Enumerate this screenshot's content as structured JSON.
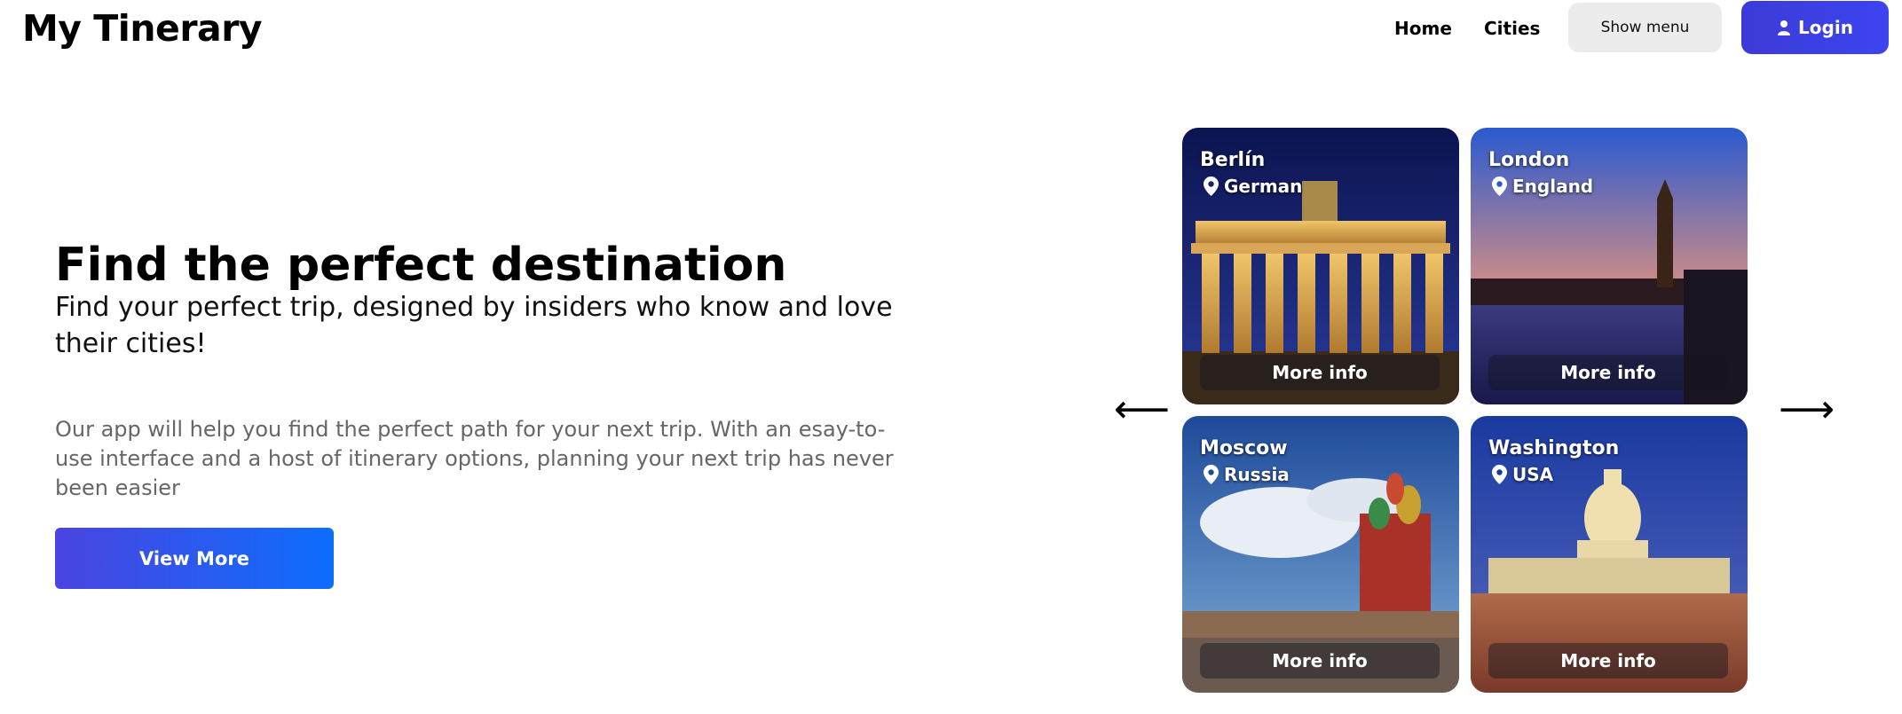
{
  "header": {
    "brand": "My Tinerary",
    "nav": {
      "home": "Home",
      "cities": "Cities"
    },
    "show_menu_label": "Show menu",
    "login_label": "Login"
  },
  "hero": {
    "title": "Find the perfect destination",
    "subtitle": "Find your perfect trip, designed by insiders who know and love their cities!",
    "description": "Our app will help you find the perfect path for your next trip. With an esay-to-use interface and a host of itinerary options, planning your next trip has never been easier",
    "cta_label": "View More"
  },
  "carousel": {
    "prev_arrow": "⟵",
    "next_arrow": "⟶",
    "cards": [
      {
        "city": "Berlín",
        "country": "German",
        "button": "More info"
      },
      {
        "city": "London",
        "country": "England",
        "button": "More info"
      },
      {
        "city": "Moscow",
        "country": "Russia",
        "button": "More info"
      },
      {
        "city": "Washington",
        "country": "USA",
        "button": "More info"
      }
    ]
  },
  "colors": {
    "login_bg": "#3b3bd6",
    "cta_gradient_start": "#4a44e0",
    "cta_gradient_end": "#0d6efd",
    "show_menu_bg": "#ececec"
  },
  "icons": {
    "login": "user-icon",
    "location": "map-pin-icon",
    "prev": "arrow-left-icon",
    "next": "arrow-right-icon"
  }
}
